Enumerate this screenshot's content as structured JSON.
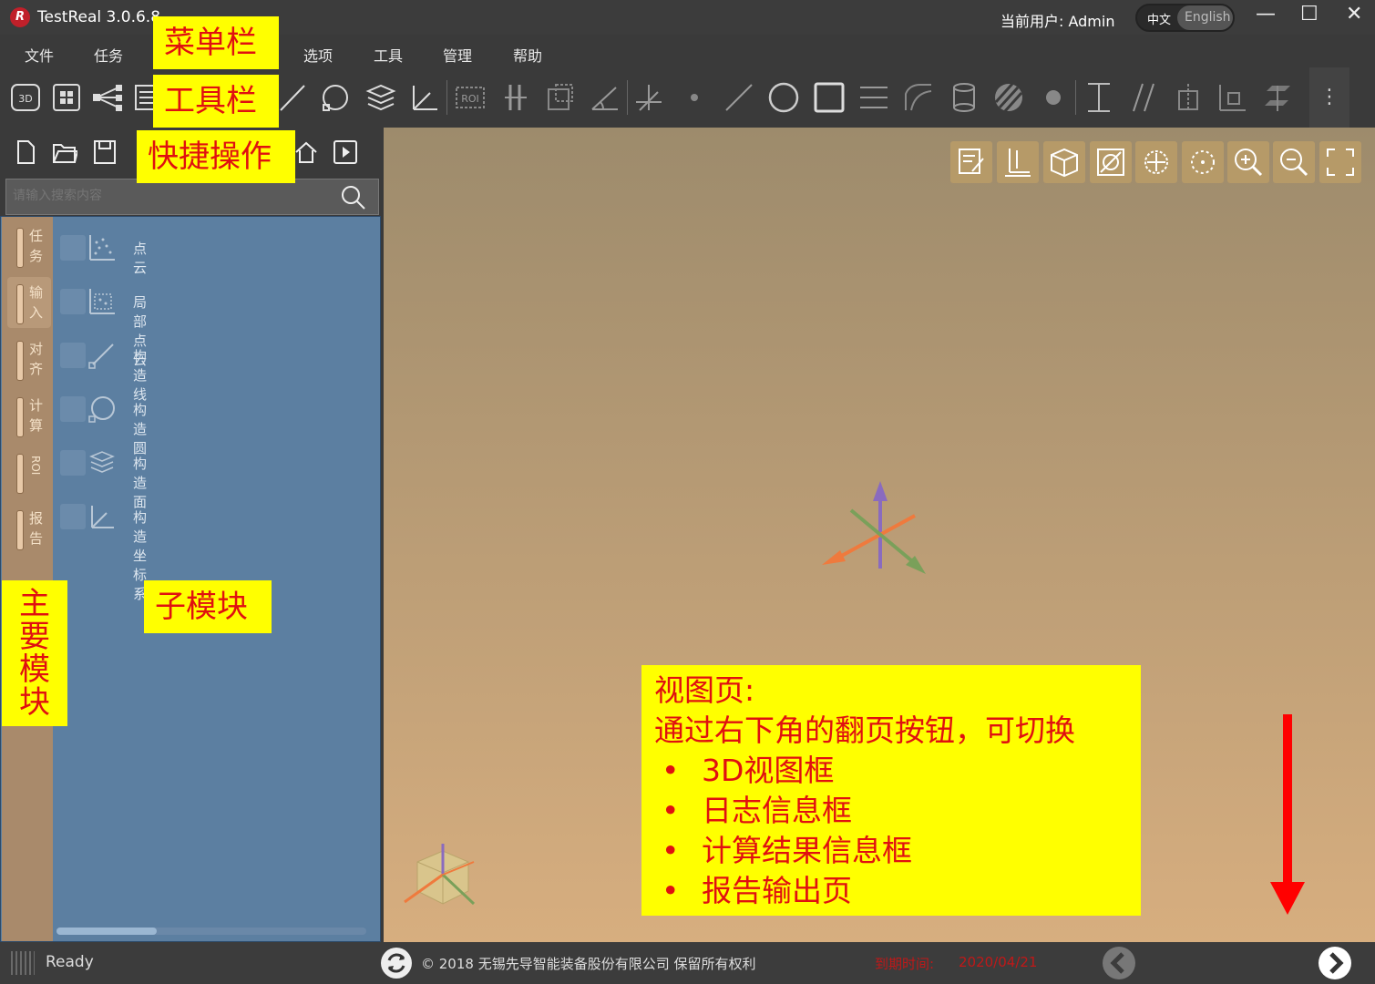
{
  "window": {
    "title": "TestReal 3.0.6.8",
    "user_label": "当前用户:  Admin",
    "lang_zh": "中文",
    "lang_en": "English",
    "minimize": "—",
    "maximize": "☐",
    "close": "✕"
  },
  "menu": {
    "items": [
      "文件",
      "任务",
      "选项",
      "工具",
      "管理",
      "帮助"
    ]
  },
  "search": {
    "placeholder": "请输入搜索内容"
  },
  "modules": {
    "tabs": [
      {
        "label": "任务"
      },
      {
        "label": "输入"
      },
      {
        "label": "对齐"
      },
      {
        "label": "计算"
      },
      {
        "label": "ROI"
      },
      {
        "label": "报告"
      }
    ],
    "active": "输入"
  },
  "submodules": {
    "items": [
      {
        "label": "点云",
        "icon": "point-cloud-icon"
      },
      {
        "label": "局部点云",
        "icon": "local-point-cloud-icon"
      },
      {
        "label": "构造线",
        "icon": "construct-line-icon"
      },
      {
        "label": "构造圆",
        "icon": "construct-circle-icon"
      },
      {
        "label": "构造面",
        "icon": "construct-plane-icon"
      },
      {
        "label": "构造坐标系",
        "icon": "construct-coordinate-icon"
      }
    ]
  },
  "status": {
    "ready": "Ready",
    "copyright": "© 2018 无锡先导智能装备股份有限公司 保留所有权利",
    "expiry_label": "到期时间:",
    "expiry_date": "2020/04/21"
  },
  "annotations": {
    "menubar": "菜单栏",
    "toolbar": "工具栏",
    "quick_ops": "快捷操作",
    "main_modules": "主要模块",
    "sub_modules": "子模块",
    "view_title": "视图页:",
    "view_desc": "通过右下角的翻页按钮，可切换",
    "view_items": [
      "3D视图框",
      "日志信息框",
      "计算结果信息框",
      "报告输出页"
    ]
  },
  "colors": {
    "accent_red": "#e01010",
    "callout_yellow": "#ffff00",
    "panel_blue": "#5c7fa1",
    "module_strip": "#a98a6b"
  }
}
